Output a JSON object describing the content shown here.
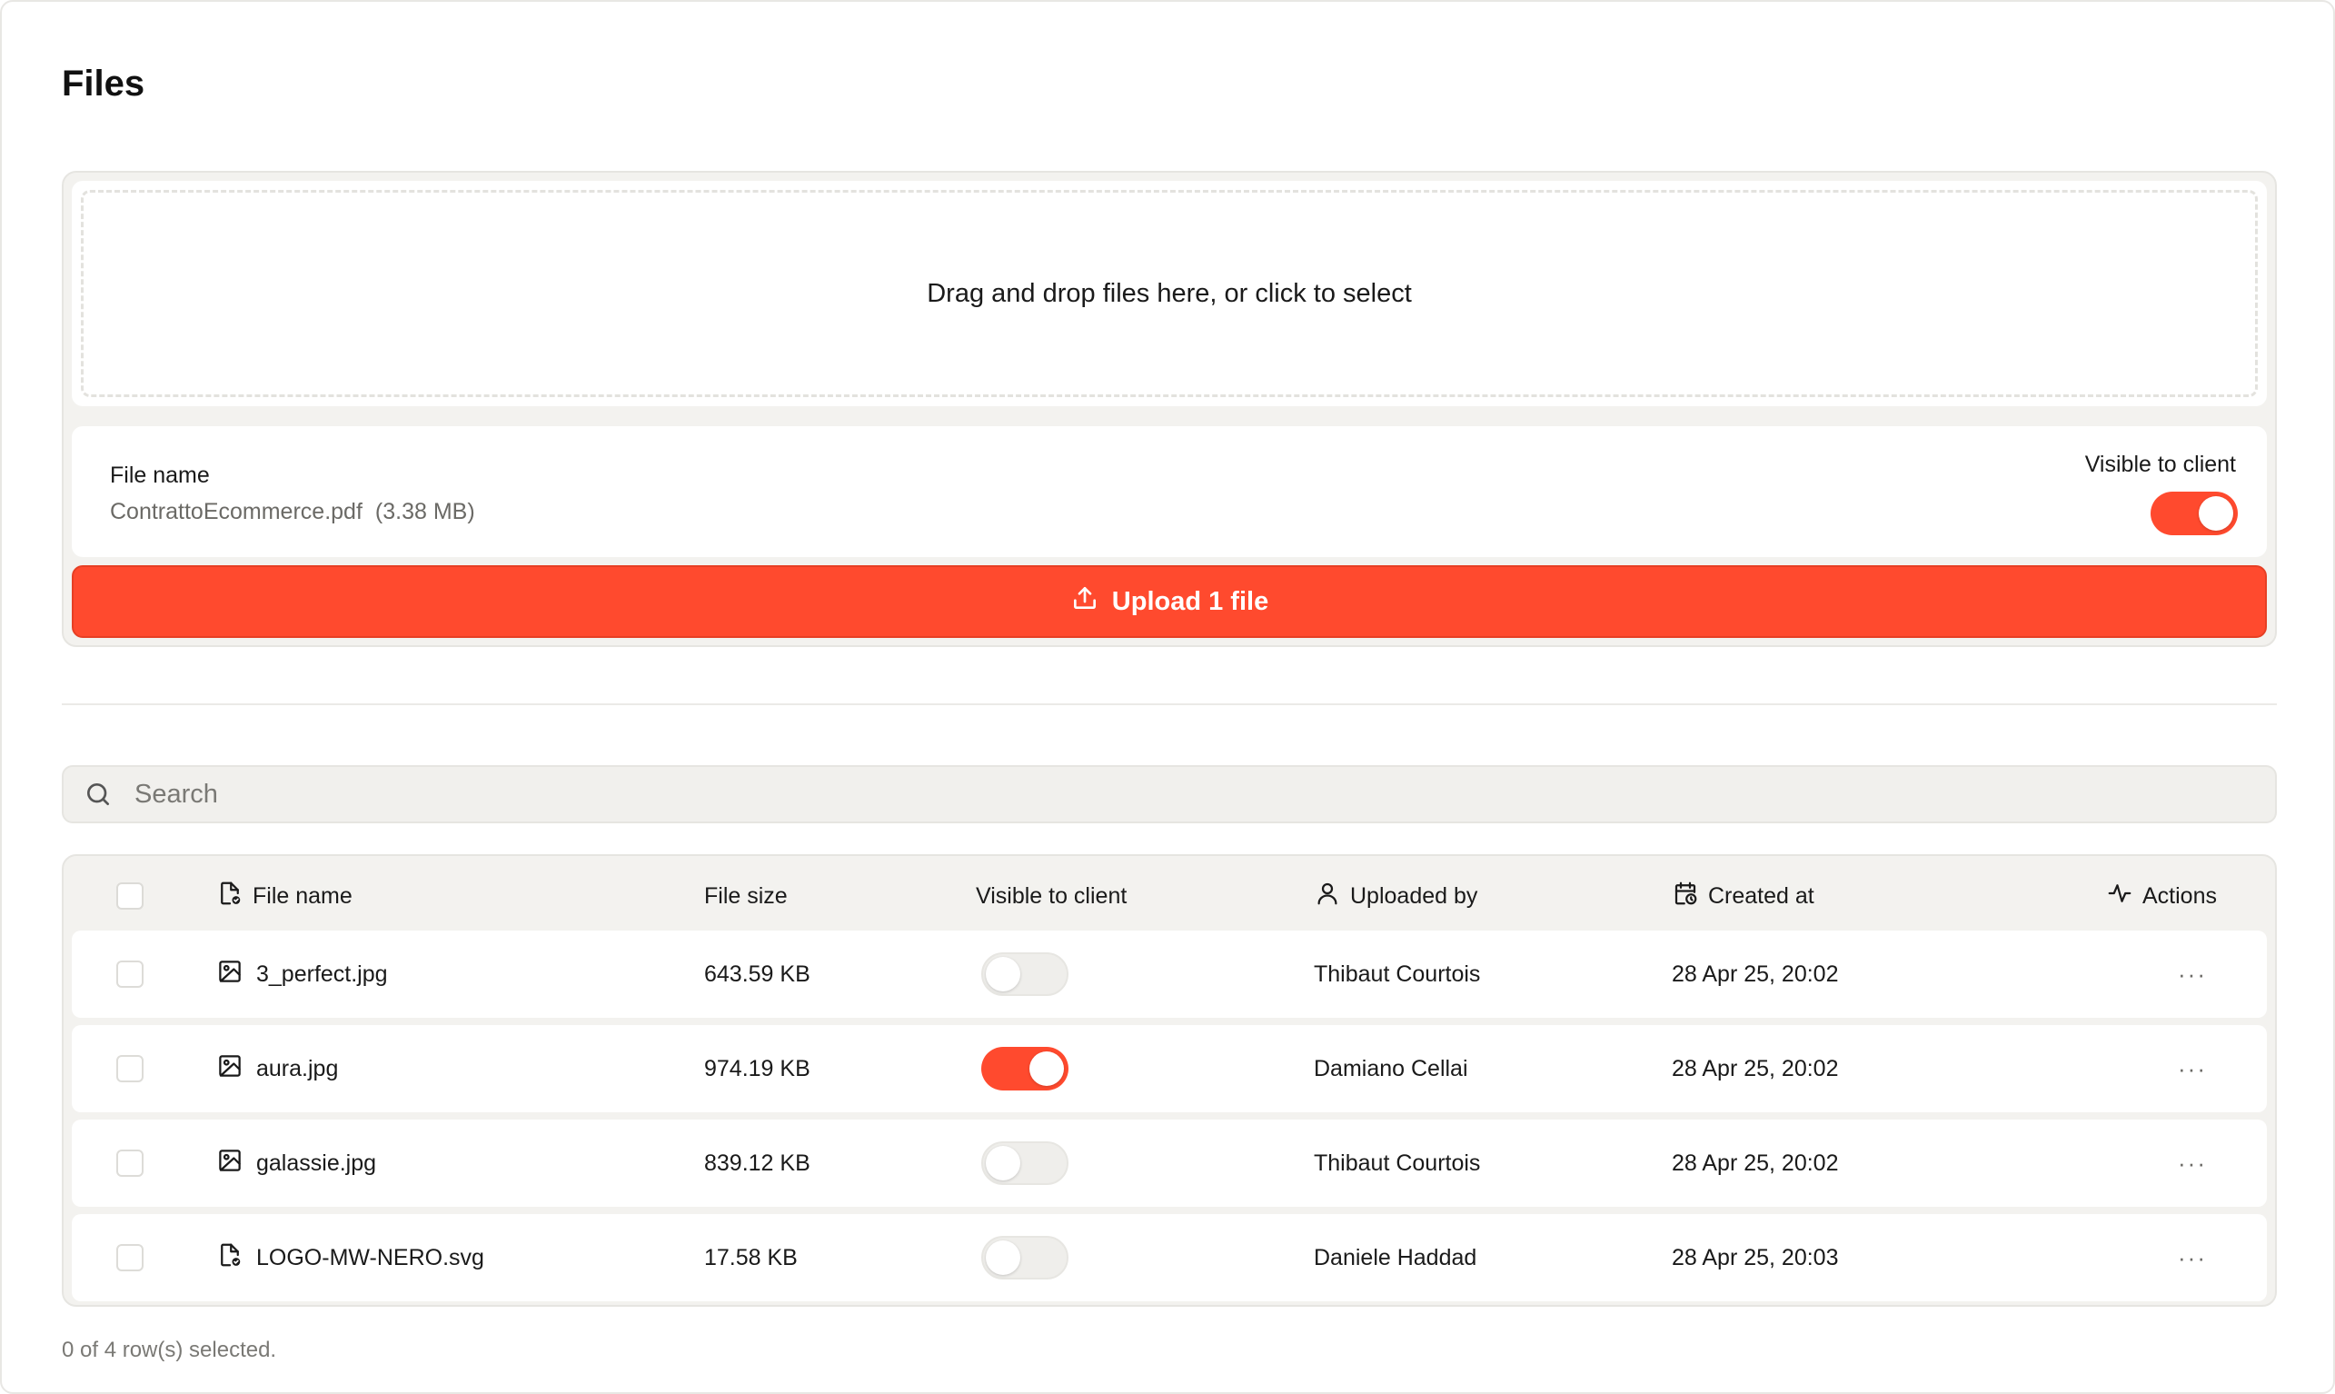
{
  "page": {
    "title": "Files"
  },
  "upload": {
    "dropzone_text": "Drag and drop files here, or click to select",
    "pending_file": {
      "label": "File name",
      "name": "ContrattoEcommerce.pdf",
      "size": "(3.38 MB)",
      "visible_label": "Visible to client",
      "visible": true
    },
    "button_label": "Upload 1 file"
  },
  "search": {
    "placeholder": "Search",
    "value": ""
  },
  "table": {
    "columns": {
      "file_name": "File name",
      "file_size": "File size",
      "visible": "Visible to client",
      "uploaded_by": "Uploaded by",
      "created_at": "Created at",
      "actions": "Actions"
    },
    "rows": [
      {
        "name": "3_perfect.jpg",
        "icon": "image-file-icon",
        "size": "643.59 KB",
        "visible": false,
        "uploaded_by": "Thibaut Courtois",
        "created_at": "28 Apr 25, 20:02"
      },
      {
        "name": "aura.jpg",
        "icon": "image-file-icon",
        "size": "974.19 KB",
        "visible": true,
        "uploaded_by": "Damiano Cellai",
        "created_at": "28 Apr 25, 20:02"
      },
      {
        "name": "galassie.jpg",
        "icon": "image-file-icon",
        "size": "839.12 KB",
        "visible": false,
        "uploaded_by": "Thibaut Courtois",
        "created_at": "28 Apr 25, 20:02"
      },
      {
        "name": "LOGO-MW-NERO.svg",
        "icon": "file-check-icon",
        "size": "17.58 KB",
        "visible": false,
        "uploaded_by": "Daniele Haddad",
        "created_at": "28 Apr 25, 20:03"
      }
    ],
    "actions_glyph": "···"
  },
  "footer": {
    "selection_status": "0 of 4 row(s) selected."
  },
  "colors": {
    "accent": "#ff4a2e",
    "panel": "#f3f2ef",
    "muted_text": "#7a7975"
  }
}
